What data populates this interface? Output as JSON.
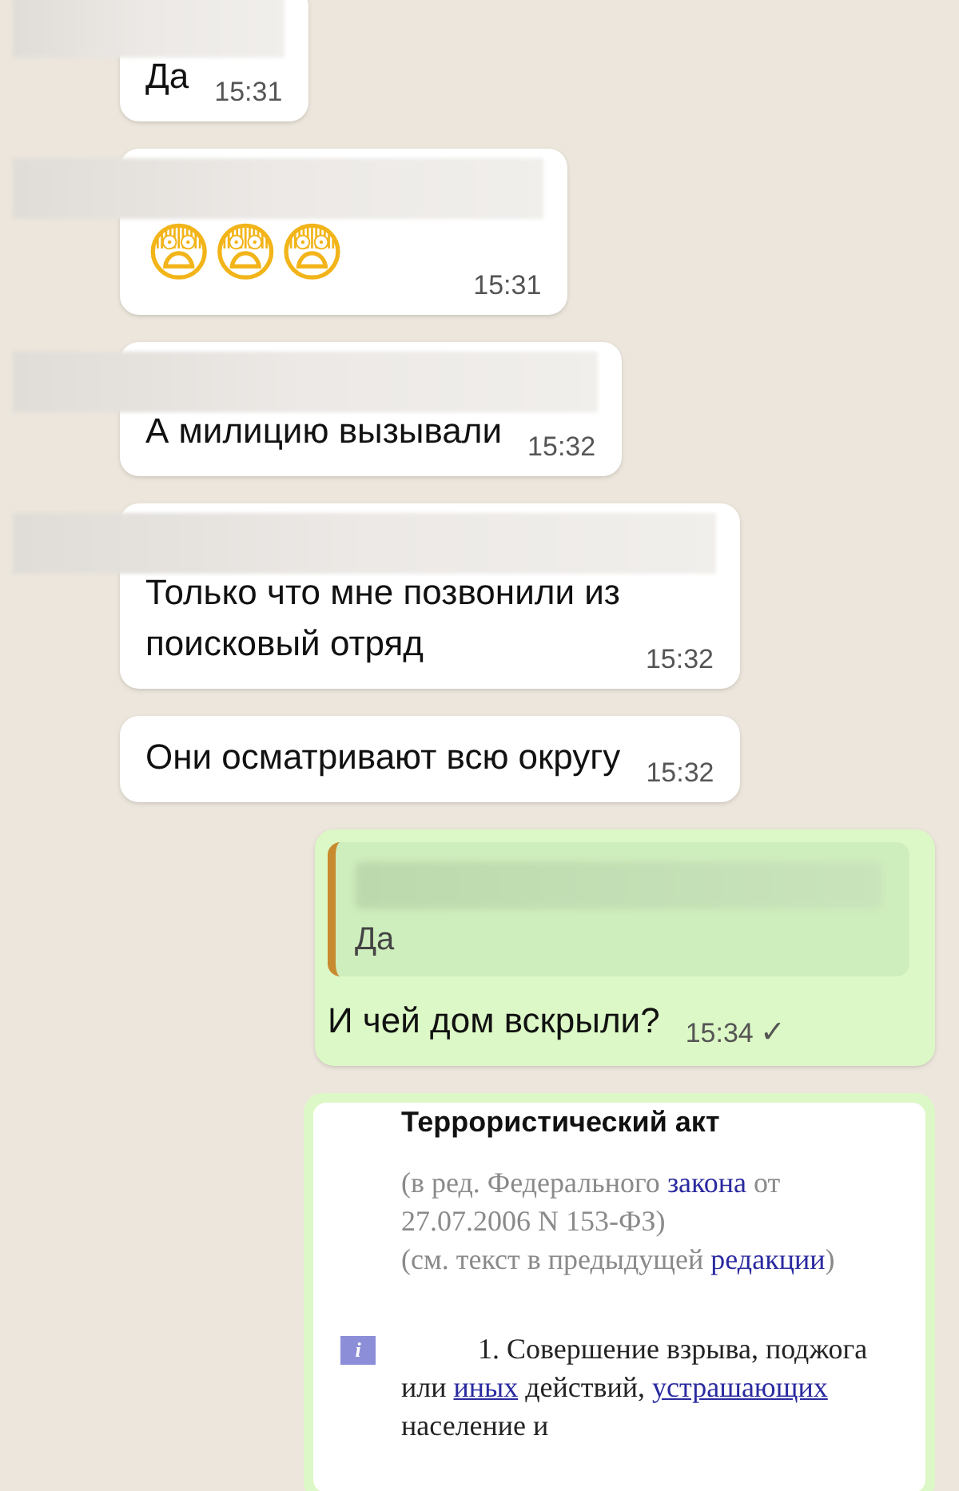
{
  "messages": [
    {
      "kind": "text",
      "outgoing": false,
      "sender_hidden": true,
      "lines": [
        "Да"
      ],
      "time": "15:31"
    },
    {
      "kind": "emoji",
      "outgoing": false,
      "sender_hidden": true,
      "lines": [
        "😨😨😨"
      ],
      "time": "15:31"
    },
    {
      "kind": "text",
      "outgoing": false,
      "sender_hidden": true,
      "lines": [
        "А милицию вызывали"
      ],
      "time": "15:32"
    },
    {
      "kind": "text",
      "outgoing": false,
      "sender_hidden": true,
      "lines": [
        "Только что мне позвонили из",
        "поисковый отряд"
      ],
      "time": "15:32"
    },
    {
      "kind": "text",
      "outgoing": false,
      "sender_hidden": false,
      "lines": [
        "Они осматривают всю округу"
      ],
      "time": "15:32"
    },
    {
      "kind": "quote",
      "outgoing": true,
      "sender_hidden": false,
      "quote": {
        "sender_hidden": true,
        "text": "Да"
      },
      "lines": [
        "И чей дом вскрыли?"
      ],
      "time": "15:34",
      "status_mark": "✓"
    },
    {
      "kind": "document",
      "outgoing": true,
      "sender_hidden": false,
      "document": {
        "title": "Террористический акт",
        "blocks": [
          {
            "kind": "note",
            "runs": [
              {
                "text": "(в ред. Федерального "
              },
              {
                "text": "закона",
                "link": true,
                "underline": false
              },
              {
                "text": " от 27.07.2006 N 153-ФЗ)"
              }
            ]
          },
          {
            "kind": "note",
            "runs": [
              {
                "text": "(см. текст в предыдущей "
              },
              {
                "text": "редакции",
                "link": true,
                "underline": false
              },
              {
                "text": ")"
              }
            ]
          },
          {
            "kind": "article",
            "info": "i",
            "runs": [
              {
                "text": "1. Совершение взрыва, поджога или "
              },
              {
                "text": "иных",
                "link": true,
                "underline": true
              },
              {
                "text": " действий, "
              },
              {
                "text": "устрашающих",
                "link": true,
                "underline": true
              },
              {
                "text": " население и"
              }
            ]
          }
        ]
      }
    }
  ]
}
